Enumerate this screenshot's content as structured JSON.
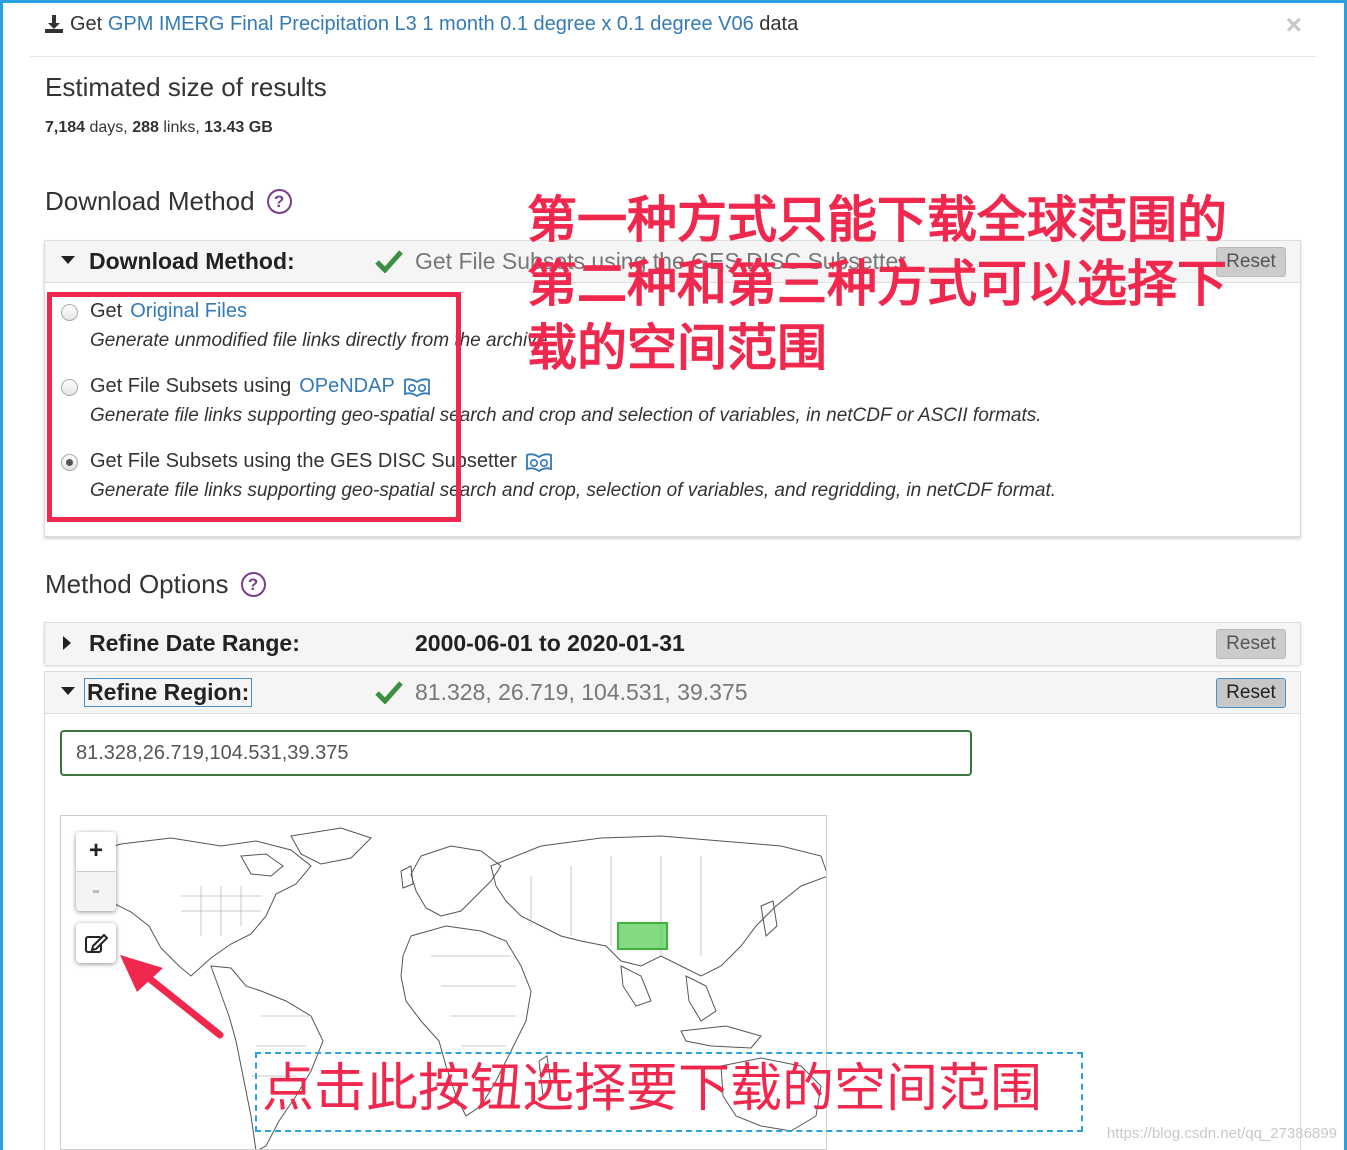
{
  "header": {
    "prefix": "Get",
    "dataset_link": "GPM IMERG Final Precipitation L3 1 month 0.1 degree x 0.1 degree V06",
    "suffix": "data",
    "close": "×"
  },
  "estimate": {
    "title": "Estimated size of results",
    "days": "7,184",
    "days_label": "days,",
    "links": "288",
    "links_label": "links,",
    "size": "13.43 GB"
  },
  "download_method": {
    "section_title": "Download Method",
    "help": "?",
    "panel_label": "Download Method:",
    "panel_value": "Get File Subsets using the GES DISC Subsetter",
    "reset": "Reset",
    "options": [
      {
        "prefix": "Get",
        "link": "Original Files",
        "desc": "Generate unmodified file links directly from the archive.",
        "checked": false
      },
      {
        "prefix": "Get File Subsets using",
        "link": "OPeNDAP",
        "desc": "Generate file links supporting geo-spatial search and crop and selection of variables, in netCDF or ASCII formats.",
        "checked": false
      },
      {
        "prefix": "Get File Subsets using the GES DISC Subsetter",
        "link": "",
        "desc": "Generate file links supporting geo-spatial search and crop, selection of variables, and regridding, in netCDF format.",
        "checked": true
      }
    ]
  },
  "method_options": {
    "section_title": "Method Options",
    "help": "?",
    "date_range": {
      "label": "Refine Date Range:",
      "value": "2000-06-01 to 2020-01-31",
      "reset": "Reset"
    },
    "region": {
      "label": "Refine Region:",
      "value": "81.328, 26.719, 104.531, 39.375",
      "reset": "Reset",
      "input_value": "81.328,26.719,104.531,39.375"
    }
  },
  "map": {
    "zoom_in": "+",
    "zoom_out": "-"
  },
  "annotations": {
    "line1": "第一种方式只能下载全球范围的",
    "line2": "第二种和第三种方式可以选择下",
    "line3": "载的空间范围",
    "bottom": "点击此按钮选择要下载的空间范围"
  },
  "watermark": "https://blog.csdn.net/qq_27386899",
  "colors": {
    "accent_red": "#f0284e",
    "link_blue": "#337ab7",
    "valid_green": "#3c763d",
    "check_green": "#3e8e41"
  }
}
